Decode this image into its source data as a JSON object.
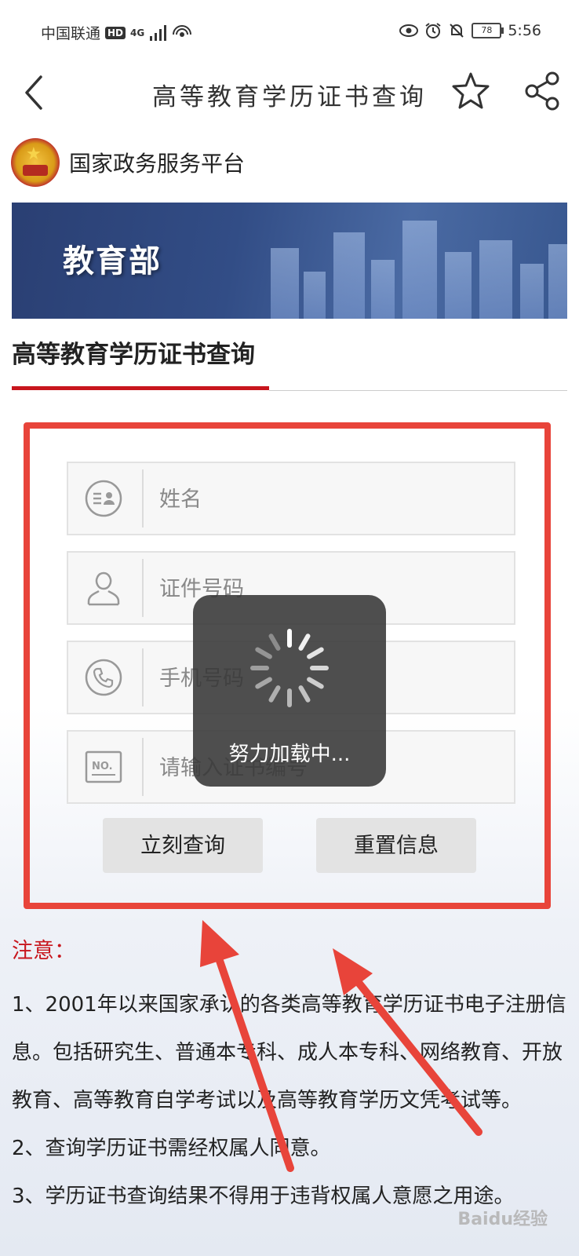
{
  "status_bar": {
    "carrier": "中国联通",
    "hd": "HD",
    "network": "4G",
    "battery": "78",
    "time": "5:56"
  },
  "navbar": {
    "title": "高等教育学历证书查询",
    "back_icon": "chevron-left-icon",
    "favorite_icon": "star-outline-icon",
    "share_icon": "share-icon"
  },
  "gov": {
    "platform_name": "国家政务服务平台",
    "emblem_icon": "national-emblem-icon"
  },
  "banner": {
    "title": "教育部"
  },
  "section": {
    "title": "高等教育学历证书查询"
  },
  "form": {
    "fields": [
      {
        "placeholder": "姓名",
        "icon": "id-card-icon"
      },
      {
        "placeholder": "证件号码",
        "icon": "person-icon"
      },
      {
        "placeholder": "手机号码",
        "icon": "phone-icon"
      },
      {
        "placeholder": "请输入证书编号",
        "icon": "no-certificate-icon"
      }
    ],
    "submit_label": "立刻查询",
    "reset_label": "重置信息"
  },
  "loading": {
    "text": "努力加载中..."
  },
  "notice": {
    "title": "注意：",
    "items": [
      "1、2001年以来国家承认的各类高等教育学历证书电子注册信息。包括研究生、普通本专科、成人本专科、网络教育、开放教育、高等教育自学考试以及高等教育学历文凭考试等。",
      "2、查询学历证书需经权属人同意。",
      "3、学历证书查询结果不得用于违背权属人意愿之用途。"
    ]
  },
  "watermark": "Baidu经验",
  "colors": {
    "accent_red": "#c8161d",
    "highlight_red": "#e8443a",
    "banner_blue": "#324d86"
  }
}
